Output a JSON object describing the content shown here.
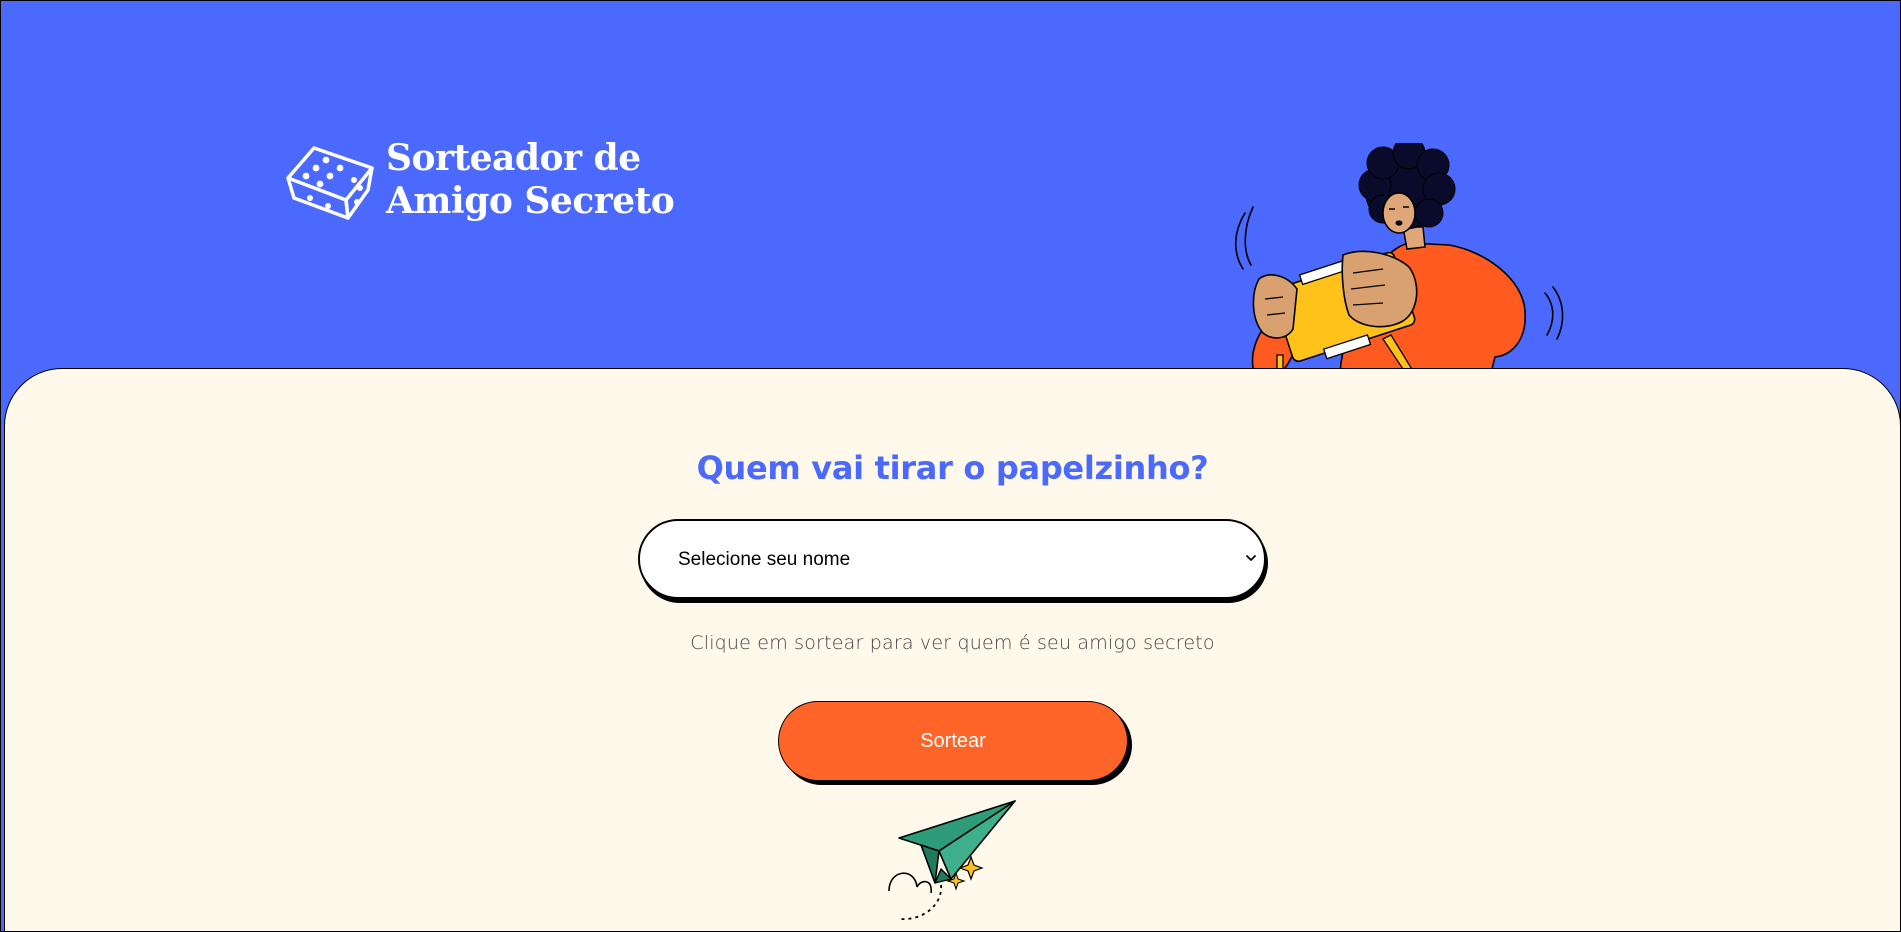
{
  "header": {
    "title_line1": "Sorteador de",
    "title_line2": "Amigo Secreto"
  },
  "main": {
    "heading": "Quem vai tirar o papelzinho?",
    "select": {
      "selected_value": "Selecione seu nome"
    },
    "hint": "Clique em sortear para ver quem é seu amigo secreto",
    "draw_button_label": "Sortear"
  },
  "colors": {
    "header_bg": "#4B69FD",
    "main_bg": "#FFF9EB",
    "heading": "#4B69FD",
    "button_bg": "#FF6428",
    "button_text": "#FFFFFF"
  },
  "icons": {
    "logo": "dice-icon",
    "select": "chevron-down-icon",
    "illustration_person": "person-with-gift-illustration",
    "illustration_plane": "paper-plane-illustration"
  }
}
